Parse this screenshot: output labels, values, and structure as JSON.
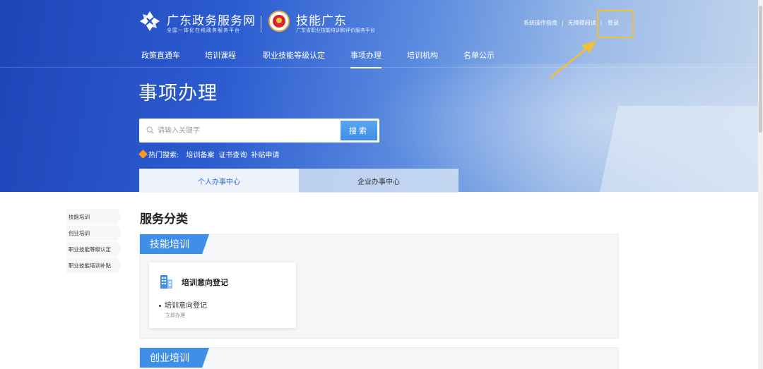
{
  "header": {
    "site1_title": "广东政务服务网",
    "site1_subtitle": "全国一体化在线政务服务平台",
    "site2_title": "技能广东",
    "site2_subtitle": "广东省职业技能培训和评价服务平台",
    "links": {
      "guide": "系统操作指南",
      "accessible": "无障碍阅读",
      "login": "登录",
      "sep": "|"
    },
    "highlight_color": "#f2c032"
  },
  "nav": {
    "items": [
      "政策直通车",
      "培训课程",
      "职业技能等级认定",
      "事项办理",
      "培训机构",
      "名单公示"
    ],
    "active_index": 3
  },
  "hero": {
    "title": "事项办理",
    "search_placeholder": "请输入关键字",
    "search_button": "搜索",
    "hot_label": "热门搜索:",
    "hot_keywords": [
      "培训备案",
      "证书查询",
      "补贴申请"
    ],
    "tabs": [
      "个人办事中心",
      "企业办事中心"
    ],
    "active_tab": 0
  },
  "sidebar": {
    "items": [
      "技能培训",
      "创业培训",
      "职业技能等级认定",
      "职业技能培训补贴"
    ]
  },
  "main": {
    "section_title": "服务分类",
    "categories": [
      {
        "tag": "技能培训",
        "cards": [
          {
            "title": "培训意向登记",
            "item": "培训意向登记",
            "action": "立即办理"
          }
        ]
      },
      {
        "tag": "创业培训"
      }
    ]
  },
  "colors": {
    "accent": "#3f8ee8",
    "hero_start": "#1f45b8",
    "hot_dot": "#ff9a1e"
  }
}
